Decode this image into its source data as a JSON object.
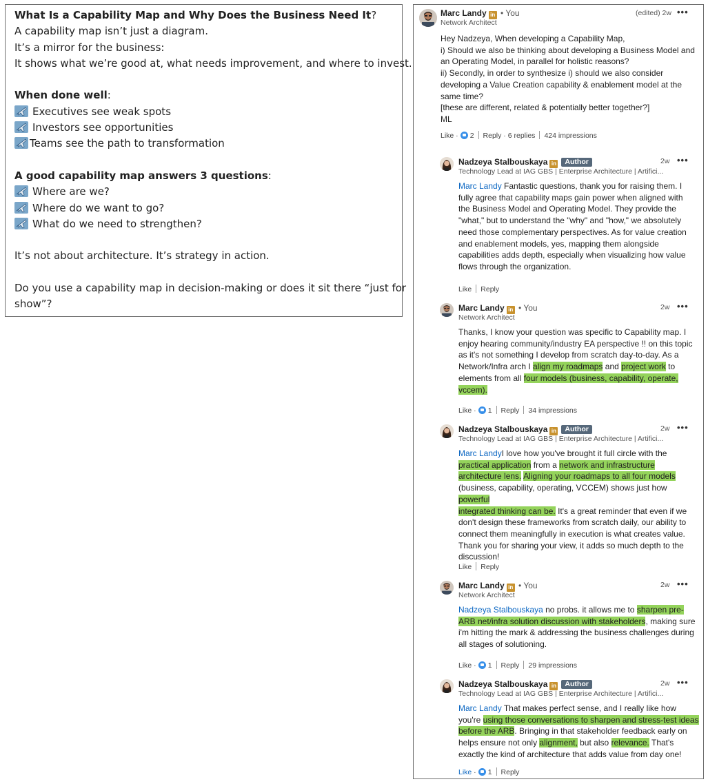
{
  "post": {
    "title": "What Is a Capability Map and Why Does the Business Need It",
    "title_suffix": "?",
    "lines": [
      "A capability map isn’t just a diagram.",
      "It’s a mirror for the business:",
      "It shows what we’re good at, what needs improvement, and where to invest."
    ],
    "done_well_heading": "When done well",
    "done_well_suffix": ":",
    "done_well_items": [
      "Executives see weak spots",
      "Investors see opportunities",
      "Teams see the path to transformation"
    ],
    "questions_heading": "A good capability map answers 3 questions",
    "questions_suffix": ":",
    "questions": [
      "Where are we?",
      "Where do we want to go?",
      "What do we need to strengthen?"
    ],
    "closing": "It’s not about architecture. It’s strategy in action.",
    "cta_line1": "Do you use a capability map in decision-making or does it sit there “just for",
    "cta_line2": "show”?"
  },
  "comments": {
    "top": {
      "name": "Marc Landy",
      "you": "• You",
      "subtitle": "Network Architect",
      "meta": "(edited) 2w",
      "more": "•••",
      "lines": [
        "Hey Nadzeya, When developing a Capability Map,",
        "i) Should we also be thinking about developing a Business Model and",
        "an Operating Model, in parallel for holistic reasons?",
        "ii) Secondly, in order to synthesize i) should we also consider",
        "developing a Value Creation capability & enablement model at the",
        "same time?",
        "[these are different, related & potentially better together?]",
        "ML"
      ],
      "like": "Like",
      "like_count": "2",
      "reply": "Reply",
      "replies": "6 replies",
      "impressions": "424 impressions"
    },
    "r1": {
      "name": "Nadzeya Stalbouskaya",
      "author": "Author",
      "subtitle": "Technology Lead at IAG GBS | Enterprise Architecture | Artifici...",
      "meta": "2w",
      "more": "•••",
      "mention": "Marc Landy",
      "p1": " Fantastic questions, thank you for raising them. I",
      "lines": [
        "fully agree that capability maps gain power when aligned with",
        "the Business Model and Operating Model. They provide the",
        "\"what,\" but to understand the \"why\" and \"how,\" we absolutely",
        "need those complementary perspectives. As for value creation",
        "and enablement models, yes, mapping them alongside",
        "capabilities adds depth, especially when visualizing how value",
        "flows through the organization."
      ],
      "like": "Like",
      "reply": "Reply"
    },
    "r2": {
      "name": "Marc Landy",
      "you": "• You",
      "subtitle": "Network Architect",
      "meta": "2w",
      "more": "•••",
      "l1": "Thanks, I know your question was specific to Capability map. I",
      "l2": "enjoy hearing community/industry EA perspective !! on this topic",
      "l3": "as it's not something I develop from scratch day-to-day. As a",
      "l4a": "Network/Infra arch I ",
      "l4b": "align my roadmaps",
      "l4c": " and ",
      "l4d": "project work",
      "l4e": " to",
      "l5a": "elements from all ",
      "l5b": "four models (business, capability, operate,",
      "l6": "vccem).",
      "like": "Like",
      "like_count": "1",
      "reply": "Reply",
      "impressions": "34 impressions"
    },
    "r3": {
      "name": "Nadzeya Stalbouskaya",
      "author": "Author",
      "subtitle": "Technology Lead at IAG GBS | Enterprise Architecture | Artifici...",
      "meta": "2w",
      "more": "•••",
      "mention": "Marc Landy",
      "l1": "I love how you've brought it full circle with the",
      "l2a": "practical application",
      "l2b": " from a ",
      "l2c": "network and infrastructure",
      "l3a": "architecture lens.",
      "l3b": " ",
      "l3c": "Aligning your roadmaps to all four models",
      "l4a": "(business, capability, operating, VCCEM) shows just how ",
      "l4b": "powerful",
      "l5a": "integrated thinking can be.",
      "l5b": " It's a great reminder that even if we",
      "l6": "don't design these frameworks from scratch daily, our ability to",
      "l7": "connect them meaningfully in execution is what creates value.",
      "l8": "Thank you for sharing your view, it adds so much depth to the",
      "l9": "discussion!",
      "like": "Like",
      "reply": "Reply"
    },
    "r4": {
      "name": "Marc Landy",
      "you": "• You",
      "subtitle": "Network Architect",
      "meta": "2w",
      "more": "•••",
      "mention": "Nadzeya Stalbouskaya",
      "l1a": " no probs. it allows me to ",
      "l1b": "sharpen pre-",
      "l2a": "ARB net/infra solution discussion with stakeholders",
      "l2b": ", making sure",
      "l3": "i'm hitting the mark & addressing the business challenges during",
      "l4": "all stages of solutioning.",
      "like": "Like",
      "like_count": "1",
      "reply": "Reply",
      "impressions": "29 impressions"
    },
    "r5": {
      "name": "Nadzeya Stalbouskaya",
      "author": "Author",
      "subtitle": "Technology Lead at IAG GBS | Enterprise Architecture | Artifici...",
      "meta": "2w",
      "more": "•••",
      "mention": "Marc Landy",
      "l1": " That makes perfect sense, and I really like how",
      "l2a": "you're ",
      "l2b": "using those conversations to sharpen and stress-test ideas",
      "l3a": "before the ARB",
      "l3b": ". Bringing in that stakeholder feedback early on",
      "l4": "helps ensure not only ",
      "l4b": "alignment,",
      "l4c": " but also ",
      "l4d": "relevance.",
      "l4e": " That's",
      "l5": "exactly the kind of architecture that adds value from day one!",
      "like": "Like",
      "like_count": "1",
      "reply": "Reply"
    }
  },
  "colors": {
    "mention": "#0a66c2",
    "highlight": "#94d35b",
    "author_badge": "#56687a",
    "linkedin_badge": "#c8922e"
  }
}
